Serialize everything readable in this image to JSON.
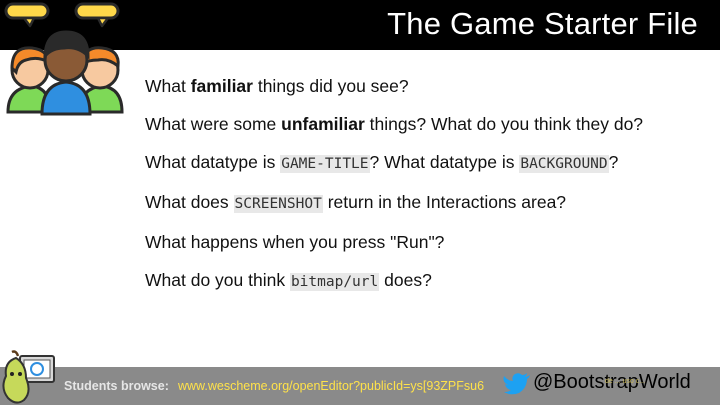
{
  "slide": {
    "title": "The Game Starter File"
  },
  "questions": [
    {
      "pre": "What ",
      "bold": "familiar",
      "post": " things did you see?"
    },
    {
      "pre": "What were some ",
      "bold": "unfamiliar",
      "post": " things? What do you think they do?"
    },
    {
      "pre": "What datatype is ",
      "code1": "GAME-TITLE",
      "mid": "? What datatype is ",
      "code2": "BACKGROUND",
      "post": "?"
    },
    {
      "pre": "What does ",
      "code1": "SCREENSHOT",
      "post": " return in the Interactions area?"
    },
    {
      "pre": "What happens when you press \"Run\"?"
    },
    {
      "pre": "What do you think ",
      "code1": "bitmap/url",
      "post": " does?"
    }
  ],
  "footer": {
    "label": "Students browse:",
    "link": "www.wescheme.org/openEditor?publicId=ys[93ZPFsu6",
    "handle": "@BootstrapWorld",
    "license": "de ... uso c..."
  },
  "colors": {
    "title_bar": "#000000",
    "footer_bar": "#8a8a8a",
    "link": "#ffe24a",
    "bird": "#1da1f2",
    "code_bg": "#e8e8e8"
  },
  "icons": [
    "people-talking-icon",
    "pear-mascot-icon",
    "twitter-bird-icon"
  ]
}
